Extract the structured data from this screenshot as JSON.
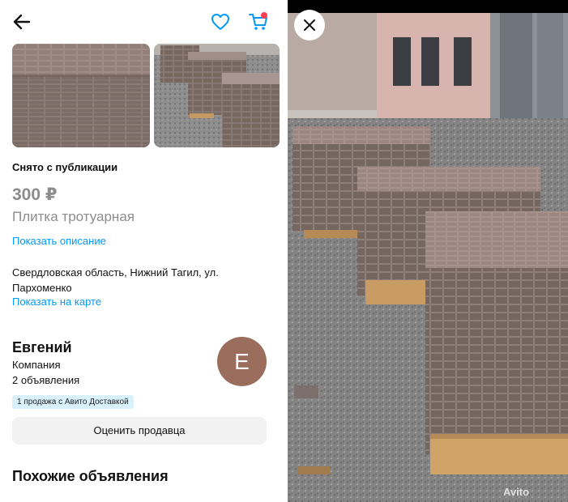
{
  "listing": {
    "status": "Снято с публикации",
    "price": "300 ₽",
    "title": "Плитка тротуарная",
    "show_description": "Показать описание",
    "address": "Свердловская область, Нижний Тагил, ул. Пархоменко",
    "show_on_map": "Показать на карте"
  },
  "seller": {
    "name": "Евгений",
    "type": "Компания",
    "listings_count": "2 объявления",
    "avatar_letter": "Е",
    "badge": "1 продажа с Авито Доставкой",
    "rate_button": "Оценить продавца"
  },
  "similar": {
    "heading": "Похожие объявления"
  },
  "viewer": {
    "watermark": "Avito"
  },
  "colors": {
    "link": "#0099f7",
    "accent_blue": "#0099f7",
    "cart_dot": "#ff4053",
    "avatar_bg": "#9b6d5c",
    "badge_bg": "#d9f1fd"
  },
  "icons": {
    "back": "arrow-left-icon",
    "favorite": "heart-icon",
    "cart": "cart-icon",
    "close": "close-icon"
  }
}
